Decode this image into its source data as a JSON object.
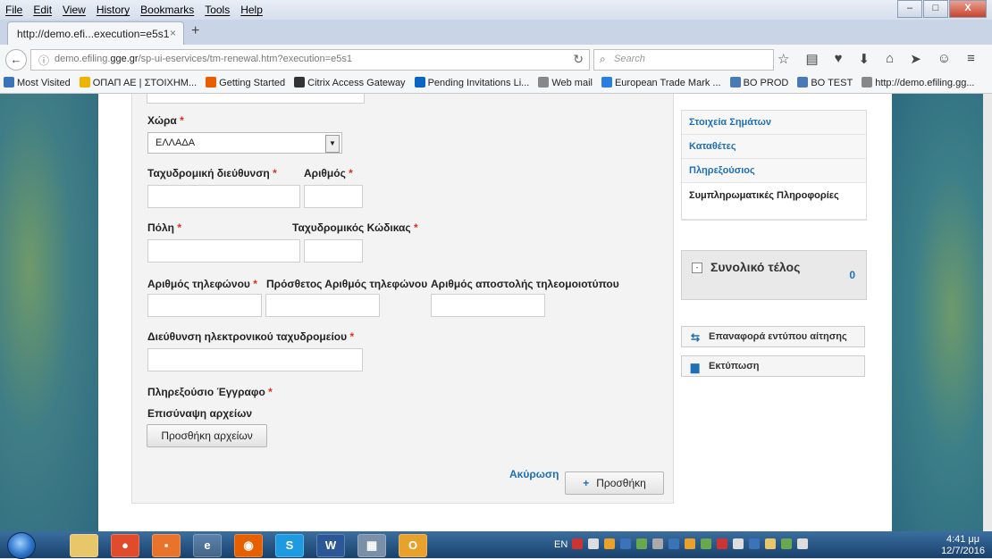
{
  "browser": {
    "menu": [
      "File",
      "Edit",
      "View",
      "History",
      "Bookmarks",
      "Tools",
      "Help"
    ],
    "tab_title": "http://demo.efi...execution=e5s1",
    "new_tab": "+",
    "url_prefix": "demo.efiling.",
    "url_domain": "gge.gr",
    "url_path": "/sp-ui-eservices/tm-renewal.htm?execution=e5s1",
    "search_placeholder": "Search",
    "bookmarks": [
      {
        "label": "Most Visited",
        "color": "#3b73b9"
      },
      {
        "label": "ΟΠΑΠ ΑΕ | ΣΤΟΙΧΗΜ...",
        "color": "#f0b400"
      },
      {
        "label": "Getting Started",
        "color": "#e66000"
      },
      {
        "label": "Citrix Access Gateway",
        "color": "#333333"
      },
      {
        "label": "Pending Invitations Li...",
        "color": "#0a66c2"
      },
      {
        "label": "Web mail",
        "color": "#888888"
      },
      {
        "label": "European Trade Mark ...",
        "color": "#2a7de1"
      },
      {
        "label": "BO PROD",
        "color": "#4a7ab5"
      },
      {
        "label": "BO TEST",
        "color": "#4a7ab5"
      },
      {
        "label": "http://demo.efiling.gg...",
        "color": "#888888"
      }
    ]
  },
  "form": {
    "country_label": "Χώρα",
    "country_value": "ΕΛΛΑΔΑ",
    "postal_address_label": "Ταχυδρομική διεύθυνση",
    "number_label": "Αριθμός",
    "city_label": "Πόλη",
    "postal_code_label": "Ταχυδρομικός Κώδικας",
    "phone_label": "Αριθμός τηλεφώνου",
    "phone2_label": "Πρόσθετος Αριθμός τηλεφώνου",
    "fax_label": "Αριθμός αποστολής τηλεομοιοτύπου",
    "email_label": "Διεύθυνση ηλεκτρονικού ταχυδρομείου",
    "proxy_doc_label": "Πληρεξούσιο Έγγραφο",
    "attach_label": "Επισύναψη αρχείων",
    "add_files_button": "Προσθήκη αρχείων",
    "cancel_link": "Ακύρωση",
    "add_button": "Προσθήκη",
    "required_mark": "*"
  },
  "sidebar": {
    "items": [
      "Στοιχεία Σημάτων",
      "Καταθέτες",
      "Πληρεξούσιος",
      "Συμπληρωματικές Πληροφορίες"
    ],
    "total_label": "Συνολικό τέλος",
    "total_value": "0",
    "reset_button": "Επαναφορά εντύπου αίτησης",
    "print_button": "Εκτύπωση"
  },
  "taskbar": {
    "lang": "EN",
    "time": "4:41 μμ",
    "date": "12/7/2016"
  }
}
